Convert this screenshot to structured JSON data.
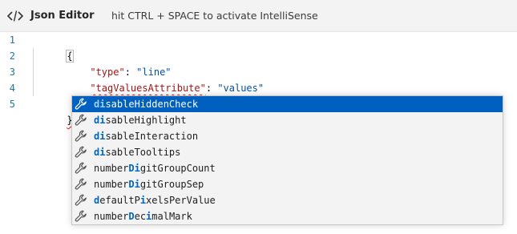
{
  "header": {
    "title": "Json Editor",
    "hint": "hit CTRL + SPACE to activate IntelliSense",
    "icon": "code-icon"
  },
  "editor": {
    "line_numbers": [
      "1",
      "2",
      "3",
      "4",
      "5"
    ],
    "lines": {
      "open_brace": "{",
      "type_key": "\"type\"",
      "type_colon": ": ",
      "type_value": "\"line\"",
      "tva_key": "\"tagValuesAttribute\"",
      "tva_colon": ": ",
      "tva_value": "\"values\"",
      "typed_text": "di",
      "close_brace": "}"
    },
    "colors": {
      "key": "#a31515",
      "string": "#0451a5",
      "line_number": "#237893"
    }
  },
  "suggestions": {
    "icon": "wrench-icon",
    "selected_index": 0,
    "items": [
      {
        "pre": "",
        "match1": "di",
        "mid": "",
        "match2": "",
        "post": "sableHiddenCheck"
      },
      {
        "pre": "",
        "match1": "di",
        "mid": "",
        "match2": "",
        "post": "sableHighlight"
      },
      {
        "pre": "",
        "match1": "di",
        "mid": "",
        "match2": "",
        "post": "sableInteraction"
      },
      {
        "pre": "",
        "match1": "di",
        "mid": "",
        "match2": "",
        "post": "sableTooltips"
      },
      {
        "pre": "number",
        "match1": "Di",
        "mid": "",
        "match2": "",
        "post": "gitGroupCount"
      },
      {
        "pre": "number",
        "match1": "Di",
        "mid": "",
        "match2": "",
        "post": "gitGroupSep"
      },
      {
        "pre": "",
        "match1": "d",
        "mid": "efaultP",
        "match2": "i",
        "post": "xelsPerValue"
      },
      {
        "pre": "number",
        "match1": "D",
        "mid": "ec",
        "match2": "i",
        "post": "malMark"
      }
    ]
  }
}
